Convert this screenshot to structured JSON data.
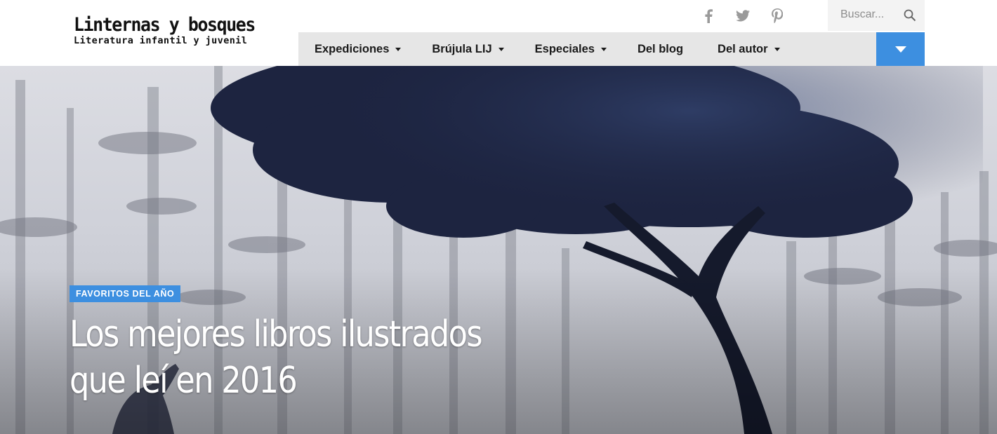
{
  "site": {
    "title": "Linternas y bosques",
    "subtitle": "Literatura infantil y juvenil"
  },
  "social": [
    {
      "icon": "facebook-icon",
      "glyph": "f"
    },
    {
      "icon": "twitter-icon",
      "glyph": "twitter"
    },
    {
      "icon": "pinterest-icon",
      "glyph": "P"
    }
  ],
  "search": {
    "placeholder": "Buscar..."
  },
  "nav": {
    "items": [
      {
        "label": "Expediciones",
        "dropdown": true
      },
      {
        "label": "Brújula LIJ",
        "dropdown": true
      },
      {
        "label": "Especiales",
        "dropdown": true
      },
      {
        "label": "Del blog",
        "dropdown": false
      },
      {
        "label": "Del autor",
        "dropdown": true
      }
    ],
    "toggle_icon": "chevron-down-icon"
  },
  "hero": {
    "category": "FAVORITOS DEL AÑO",
    "title_line1": "Los mejores libros ilustrados",
    "title_line2": "que leí en 2016"
  },
  "colors": {
    "accent": "#3d8fe0",
    "nav_bg": "#e6e6e6",
    "search_bg": "#f3f3f3",
    "social": "#9a9a9a"
  }
}
